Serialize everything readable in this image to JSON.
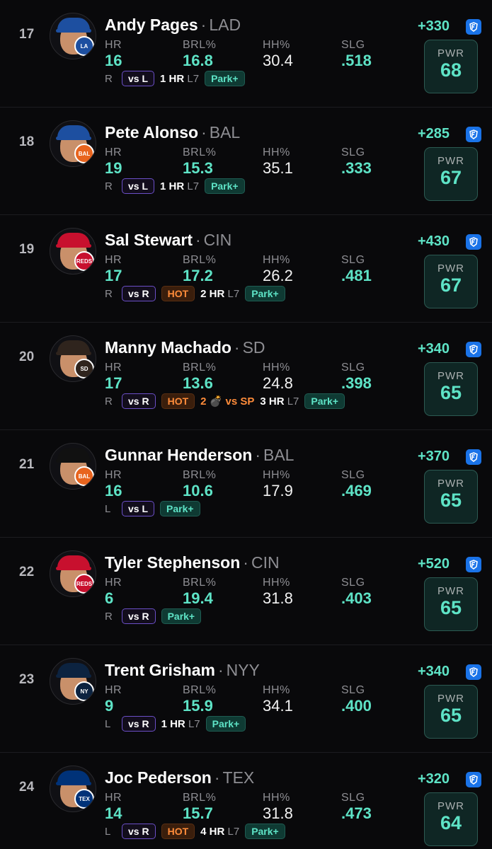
{
  "colors": {
    "accent": "#5ee3c6",
    "hot": "#ff8c3a",
    "vs_border": "#6b4fc7",
    "fanduel": "#1a73e8"
  },
  "labels": {
    "hr": "HR",
    "brl": "BRL%",
    "hh": "HH%",
    "slg": "SLG",
    "pwr": "PWR",
    "park": "Park+",
    "hot": "HOT",
    "l7": "L7",
    "dot": "·"
  },
  "players": [
    {
      "rank": "17",
      "name": "Andy Pages",
      "team": "LAD",
      "hr": "16",
      "brl": "16.8",
      "hh": "30.4",
      "slg": ".518",
      "hand": "R",
      "vs": "vs L",
      "hot": false,
      "hr_l7": "1 HR",
      "bomb": "",
      "odds": "+330",
      "pwr": "68",
      "cap": "#1d4fa0",
      "logo_bg": "#1d4fa0",
      "logo": "LA"
    },
    {
      "rank": "18",
      "name": "Pete Alonso",
      "team": "BAL",
      "hr": "19",
      "brl": "15.3",
      "hh": "35.1",
      "slg": ".333",
      "hand": "R",
      "vs": "vs L",
      "hot": false,
      "hr_l7": "1 HR",
      "bomb": "",
      "odds": "+285",
      "pwr": "67",
      "cap": "#1d4fa0",
      "logo_bg": "#e8641e",
      "logo": "BAL"
    },
    {
      "rank": "19",
      "name": "Sal Stewart",
      "team": "CIN",
      "hr": "17",
      "brl": "17.2",
      "hh": "26.2",
      "slg": ".481",
      "hand": "R",
      "vs": "vs R",
      "hot": true,
      "hr_l7": "2 HR",
      "bomb": "",
      "odds": "+430",
      "pwr": "67",
      "cap": "#c8102e",
      "logo_bg": "#c8102e",
      "logo": "REDS"
    },
    {
      "rank": "20",
      "name": "Manny Machado",
      "team": "SD",
      "hr": "17",
      "brl": "13.6",
      "hh": "24.8",
      "slg": ".398",
      "hand": "R",
      "vs": "vs R",
      "hot": true,
      "hr_l7": "3 HR",
      "bomb": "2 💣 vs SP",
      "odds": "+340",
      "pwr": "65",
      "cap": "#2f241d",
      "logo_bg": "#2f241d",
      "logo": "SD"
    },
    {
      "rank": "21",
      "name": "Gunnar Henderson",
      "team": "BAL",
      "hr": "16",
      "brl": "10.6",
      "hh": "17.9",
      "slg": ".469",
      "hand": "L",
      "vs": "vs L",
      "hot": false,
      "hr_l7": "",
      "bomb": "",
      "odds": "+370",
      "pwr": "65",
      "cap": "#111111",
      "logo_bg": "#e8641e",
      "logo": "BAL"
    },
    {
      "rank": "22",
      "name": "Tyler Stephenson",
      "team": "CIN",
      "hr": "6",
      "brl": "19.4",
      "hh": "31.8",
      "slg": ".403",
      "hand": "R",
      "vs": "vs R",
      "hot": false,
      "hr_l7": "",
      "bomb": "",
      "odds": "+520",
      "pwr": "65",
      "cap": "#c8102e",
      "logo_bg": "#c8102e",
      "logo": "REDS"
    },
    {
      "rank": "23",
      "name": "Trent Grisham",
      "team": "NYY",
      "hr": "9",
      "brl": "15.9",
      "hh": "34.1",
      "slg": ".400",
      "hand": "L",
      "vs": "vs R",
      "hot": false,
      "hr_l7": "1 HR",
      "bomb": "",
      "odds": "+340",
      "pwr": "65",
      "cap": "#0c2340",
      "logo_bg": "#0c2340",
      "logo": "NY"
    },
    {
      "rank": "24",
      "name": "Joc Pederson",
      "team": "TEX",
      "hr": "14",
      "brl": "15.7",
      "hh": "31.8",
      "slg": ".473",
      "hand": "L",
      "vs": "vs R",
      "hot": true,
      "hr_l7": "4 HR",
      "bomb": "",
      "odds": "+320",
      "pwr": "64",
      "cap": "#003278",
      "logo_bg": "#003278",
      "logo": "TEX"
    }
  ]
}
